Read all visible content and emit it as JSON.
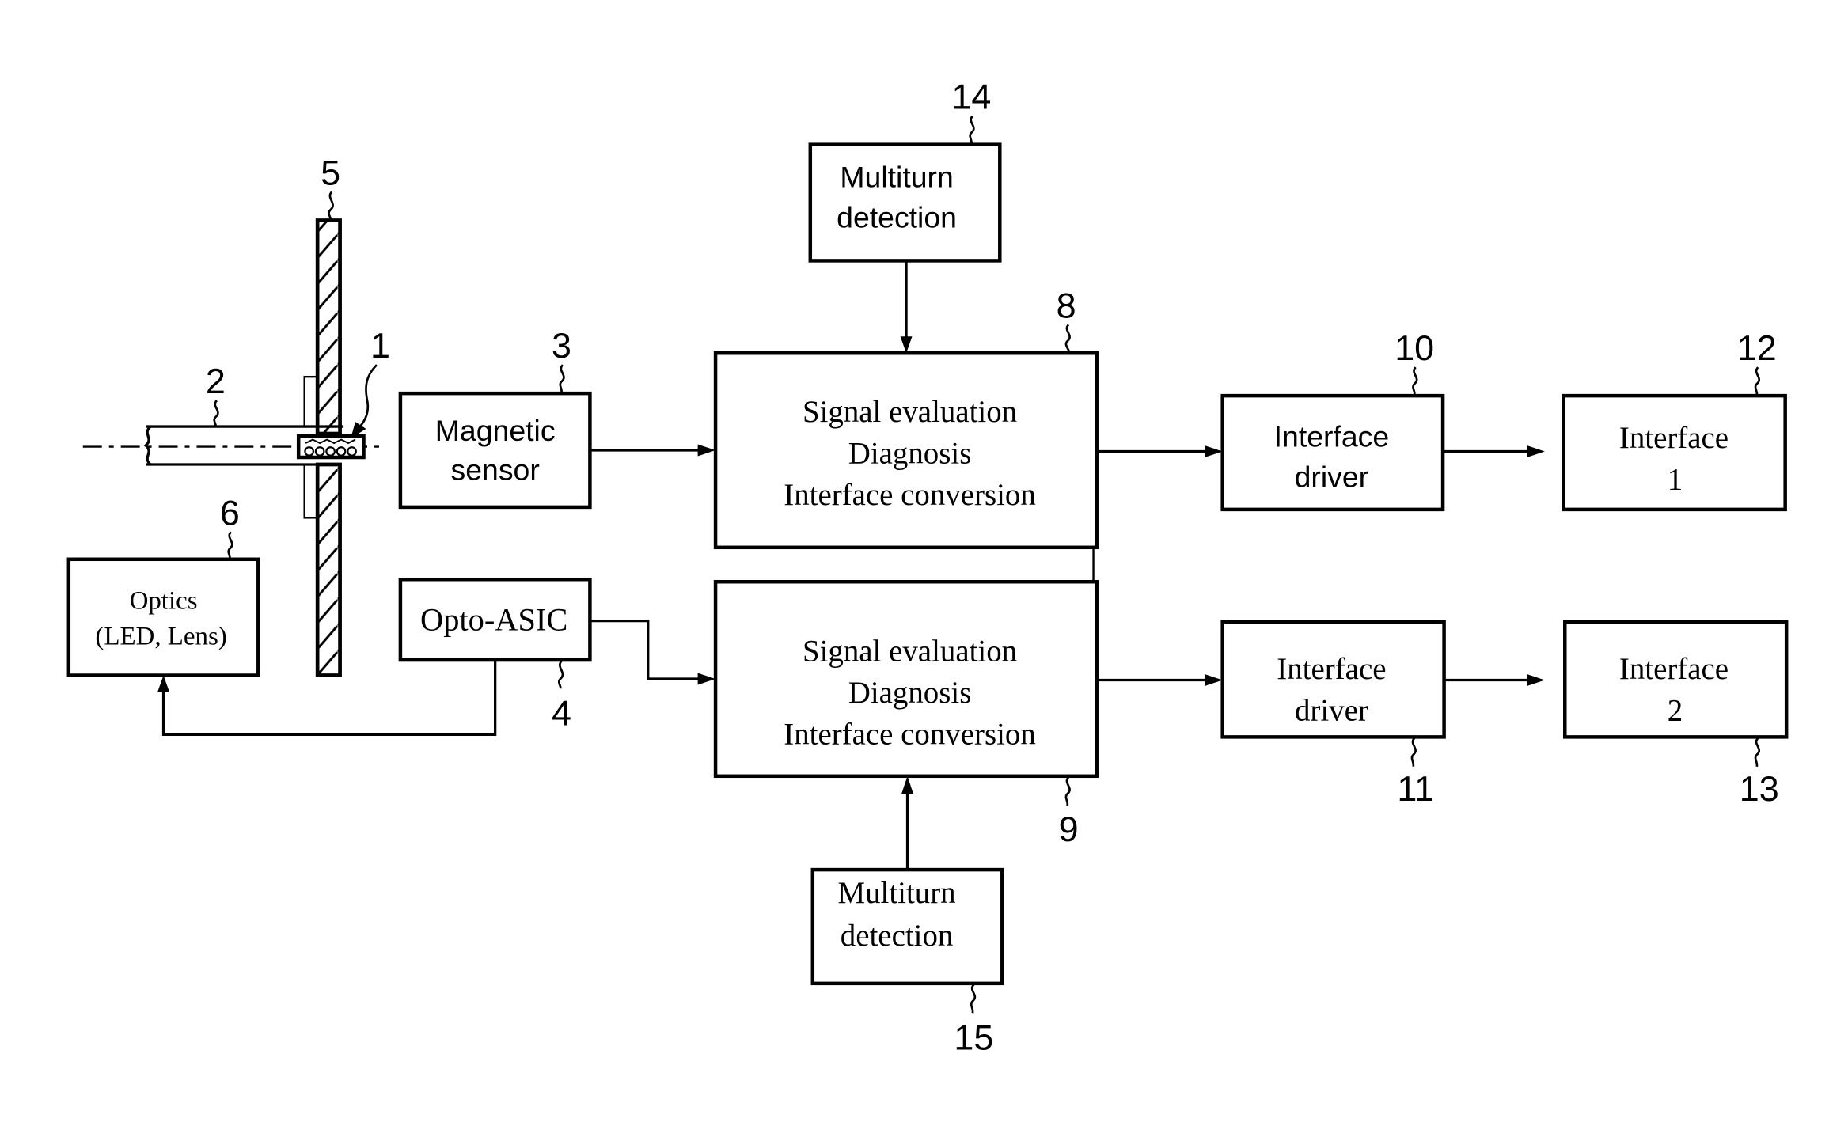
{
  "figure": {
    "type": "block-diagram",
    "subject": "Position encoder with magnetic and optical sensing channels"
  },
  "mechanical": {
    "shaft": {
      "ref": "2"
    },
    "magnet": {
      "ref": "1"
    },
    "code_disc": {
      "ref": "5"
    }
  },
  "blocks": {
    "optics": {
      "ref": "6",
      "lines": [
        "Optics",
        "(LED, Lens)"
      ]
    },
    "magnetic_sensor": {
      "ref": "3",
      "lines": [
        "Magnetic",
        "sensor"
      ]
    },
    "opto_asic": {
      "ref": "4",
      "lines": [
        "Opto-ASIC"
      ]
    },
    "signal_eval_1": {
      "ref": "8",
      "lines": [
        "Signal evaluation",
        "Diagnosis",
        "Interface conversion"
      ]
    },
    "signal_eval_2": {
      "ref": "9",
      "lines": [
        "Signal evaluation",
        "Diagnosis",
        "Interface conversion"
      ]
    },
    "multiturn_1": {
      "ref": "14",
      "lines": [
        "Multiturn",
        "detection"
      ]
    },
    "multiturn_2": {
      "ref": "15",
      "lines": [
        "Multiturn",
        "detection"
      ]
    },
    "interface_driver_1": {
      "ref": "10",
      "lines": [
        "Interface",
        "driver"
      ]
    },
    "interface_driver_2": {
      "ref": "11",
      "lines": [
        "Interface",
        "driver"
      ]
    },
    "interface_1": {
      "ref": "12",
      "lines": [
        "Interface",
        "1"
      ]
    },
    "interface_2": {
      "ref": "13",
      "lines": [
        "Interface",
        "2"
      ]
    }
  },
  "connections": [
    {
      "from": "magnetic_sensor",
      "to": "signal_eval_1"
    },
    {
      "from": "opto_asic",
      "to": "signal_eval_2"
    },
    {
      "from": "opto_asic",
      "to": "optics"
    },
    {
      "from": "multiturn_1",
      "to": "signal_eval_1"
    },
    {
      "from": "multiturn_2",
      "to": "signal_eval_2"
    },
    {
      "from": "signal_eval_1",
      "to": "interface_driver_1"
    },
    {
      "from": "signal_eval_2",
      "to": "interface_driver_2"
    },
    {
      "from": "interface_driver_1",
      "to": "interface_1"
    },
    {
      "from": "interface_driver_2",
      "to": "interface_2"
    },
    {
      "from": "signal_eval_1",
      "to": "signal_eval_2",
      "style": "link"
    }
  ]
}
